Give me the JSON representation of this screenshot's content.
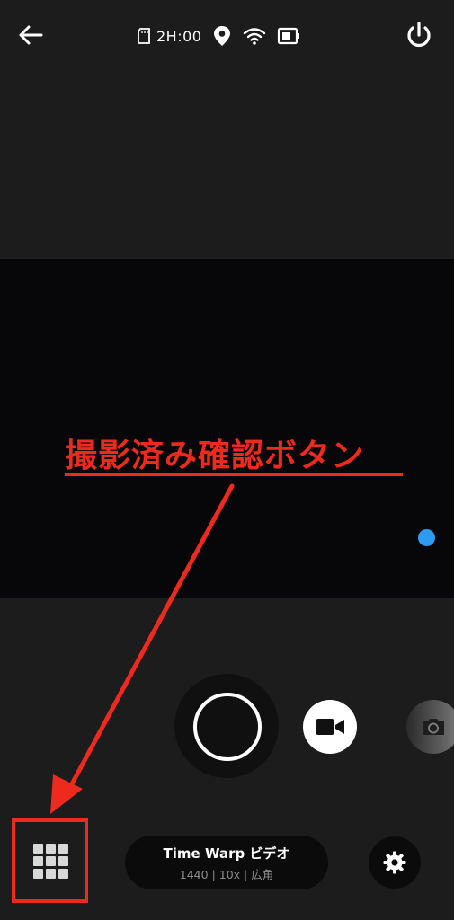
{
  "status_bar": {
    "remaining_time": "2H:00"
  },
  "icons": {
    "back": "back-arrow-icon",
    "sd": "sd-card-icon",
    "location": "location-pin-icon",
    "wifi": "wifi-icon",
    "battery": "battery-icon",
    "power": "power-icon",
    "video_mode": "video-camera-icon",
    "photo_mode": "camera-icon",
    "media": "grid-icon",
    "settings": "gear-icon"
  },
  "annotation": {
    "label": "撮影済み確認ボタン"
  },
  "mode": {
    "title": "Time Warp ビデオ",
    "details": "1440 | 10x | 広角"
  },
  "colors": {
    "annotation": "#ee2a1f",
    "accent_dot": "#2d9bf0",
    "background": "#1c1c1d"
  }
}
